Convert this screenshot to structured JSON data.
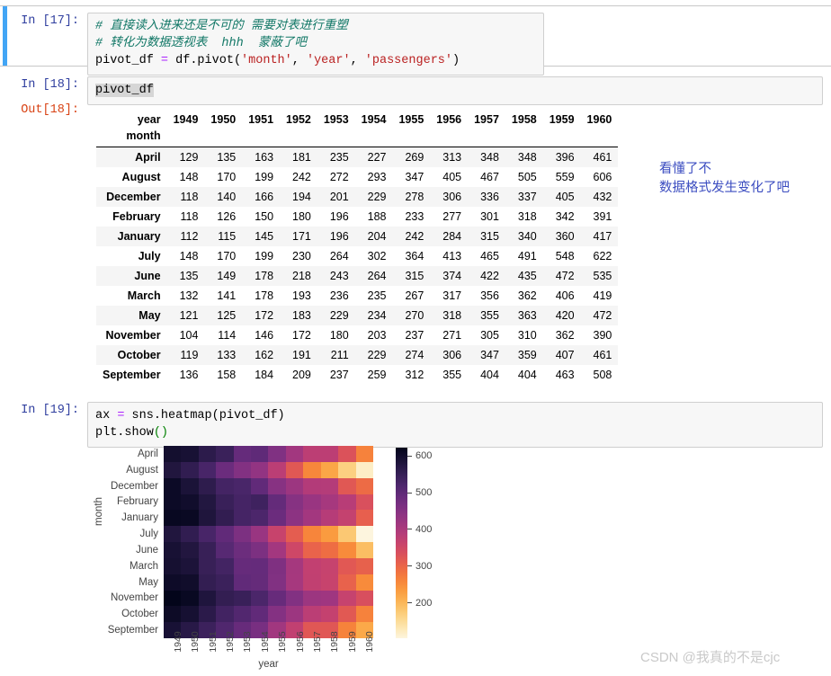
{
  "cells": [
    {
      "prompt": "In  [17]:",
      "code_lines": [
        {
          "type": "comment",
          "text": "# 直接读入进来还是不可的 需要对表进行重塑"
        },
        {
          "type": "comment",
          "text": "# 转化为数据透视表  hhh  蒙蔽了吧"
        },
        {
          "type": "code",
          "text": "pivot_df = df.pivot('month', 'year', 'passengers')"
        }
      ]
    },
    {
      "prompt": "In  [18]:",
      "code_lines": [
        {
          "type": "code",
          "text": "pivot_df"
        }
      ]
    },
    {
      "prompt": "Out[18]:",
      "code_lines": []
    },
    {
      "prompt": "In  [19]:",
      "code_lines": [
        {
          "type": "code",
          "text": "ax = sns.heatmap(pivot_df)"
        },
        {
          "type": "code",
          "text": "plt.show()"
        }
      ]
    }
  ],
  "dataframe": {
    "column_index_name": "year",
    "row_index_name": "month",
    "columns": [
      "1949",
      "1950",
      "1951",
      "1952",
      "1953",
      "1954",
      "1955",
      "1956",
      "1957",
      "1958",
      "1959",
      "1960"
    ],
    "rows": [
      {
        "month": "April",
        "values": [
          129,
          135,
          163,
          181,
          235,
          227,
          269,
          313,
          348,
          348,
          396,
          461
        ]
      },
      {
        "month": "August",
        "values": [
          148,
          170,
          199,
          242,
          272,
          293,
          347,
          405,
          467,
          505,
          559,
          606
        ]
      },
      {
        "month": "December",
        "values": [
          118,
          140,
          166,
          194,
          201,
          229,
          278,
          306,
          336,
          337,
          405,
          432
        ]
      },
      {
        "month": "February",
        "values": [
          118,
          126,
          150,
          180,
          196,
          188,
          233,
          277,
          301,
          318,
          342,
          391
        ]
      },
      {
        "month": "January",
        "values": [
          112,
          115,
          145,
          171,
          196,
          204,
          242,
          284,
          315,
          340,
          360,
          417
        ]
      },
      {
        "month": "July",
        "values": [
          148,
          170,
          199,
          230,
          264,
          302,
          364,
          413,
          465,
          491,
          548,
          622
        ]
      },
      {
        "month": "June",
        "values": [
          135,
          149,
          178,
          218,
          243,
          264,
          315,
          374,
          422,
          435,
          472,
          535
        ]
      },
      {
        "month": "March",
        "values": [
          132,
          141,
          178,
          193,
          236,
          235,
          267,
          317,
          356,
          362,
          406,
          419
        ]
      },
      {
        "month": "May",
        "values": [
          121,
          125,
          172,
          183,
          229,
          234,
          270,
          318,
          355,
          363,
          420,
          472
        ]
      },
      {
        "month": "November",
        "values": [
          104,
          114,
          146,
          172,
          180,
          203,
          237,
          271,
          305,
          310,
          362,
          390
        ]
      },
      {
        "month": "October",
        "values": [
          119,
          133,
          162,
          191,
          211,
          229,
          274,
          306,
          347,
          359,
          407,
          461
        ]
      },
      {
        "month": "September",
        "values": [
          136,
          158,
          184,
          209,
          237,
          259,
          312,
          355,
          404,
          404,
          463,
          508
        ]
      }
    ]
  },
  "annotation": {
    "text": "看懂了不\n数据格式发生变化了吧",
    "color": "#3B4CC0"
  },
  "chart_data": {
    "type": "heatmap",
    "title": "",
    "xlabel": "year",
    "ylabel": "month",
    "colormap": "rocket",
    "x": [
      "1949",
      "1950",
      "1951",
      "1952",
      "1953",
      "1954",
      "1955",
      "1956",
      "1957",
      "1958",
      "1959",
      "1960"
    ],
    "y": [
      "April",
      "August",
      "December",
      "February",
      "January",
      "July",
      "June",
      "March",
      "May",
      "November",
      "October",
      "September"
    ],
    "values": [
      [
        129,
        135,
        163,
        181,
        235,
        227,
        269,
        313,
        348,
        348,
        396,
        461
      ],
      [
        148,
        170,
        199,
        242,
        272,
        293,
        347,
        405,
        467,
        505,
        559,
        606
      ],
      [
        118,
        140,
        166,
        194,
        201,
        229,
        278,
        306,
        336,
        337,
        405,
        432
      ],
      [
        118,
        126,
        150,
        180,
        196,
        188,
        233,
        277,
        301,
        318,
        342,
        391
      ],
      [
        112,
        115,
        145,
        171,
        196,
        204,
        242,
        284,
        315,
        340,
        360,
        417
      ],
      [
        148,
        170,
        199,
        230,
        264,
        302,
        364,
        413,
        465,
        491,
        548,
        622
      ],
      [
        135,
        149,
        178,
        218,
        243,
        264,
        315,
        374,
        422,
        435,
        472,
        535
      ],
      [
        132,
        141,
        178,
        193,
        236,
        235,
        267,
        317,
        356,
        362,
        406,
        419
      ],
      [
        121,
        125,
        172,
        183,
        229,
        234,
        270,
        318,
        355,
        363,
        420,
        472
      ],
      [
        104,
        114,
        146,
        172,
        180,
        203,
        237,
        271,
        305,
        310,
        362,
        390
      ],
      [
        119,
        133,
        162,
        191,
        211,
        229,
        274,
        306,
        347,
        359,
        407,
        461
      ],
      [
        136,
        158,
        184,
        209,
        237,
        259,
        312,
        355,
        404,
        404,
        463,
        508
      ]
    ],
    "colorbar": {
      "ticks": [
        200,
        300,
        400,
        500,
        600
      ],
      "vmin": 104,
      "vmax": 622
    }
  },
  "watermark": {
    "text": "CSDN @我真的不是cjc"
  }
}
